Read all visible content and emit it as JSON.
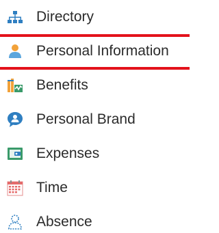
{
  "nav": {
    "items": [
      {
        "label": "Directory",
        "icon": "org-chart-icon"
      },
      {
        "label": "Personal Information",
        "icon": "person-icon",
        "highlighted": true
      },
      {
        "label": "Benefits",
        "icon": "benefits-icon"
      },
      {
        "label": "Personal Brand",
        "icon": "chat-bubble-icon"
      },
      {
        "label": "Expenses",
        "icon": "wallet-icon"
      },
      {
        "label": "Time",
        "icon": "calendar-icon"
      },
      {
        "label": "Absence",
        "icon": "absence-person-icon"
      }
    ]
  },
  "colors": {
    "highlight_border": "#e3121b",
    "icon_blue": "#2f7fc1",
    "icon_light_blue": "#5ba6dd",
    "icon_green": "#3a9a6a",
    "icon_orange": "#f2a23a",
    "label_text": "#2b2b2b"
  }
}
